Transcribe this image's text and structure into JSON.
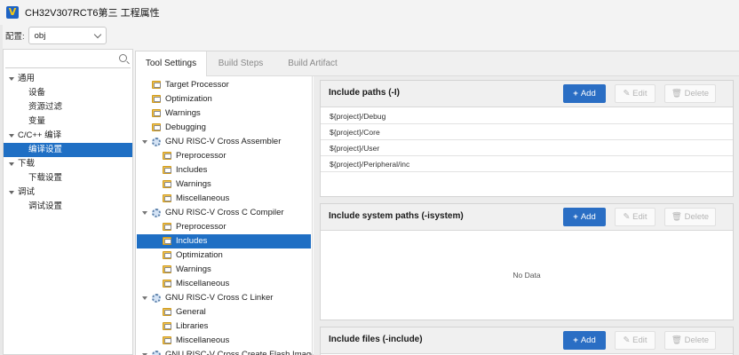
{
  "window": {
    "title": "CH32V307RCT6第三 工程属性",
    "logo": "V"
  },
  "config": {
    "label": "配置:",
    "value": "obj"
  },
  "left_tree": [
    {
      "label": "通用",
      "level": 0,
      "expanded": true
    },
    {
      "label": "设备",
      "level": 1
    },
    {
      "label": "资源过滤",
      "level": 1
    },
    {
      "label": "变量",
      "level": 1
    },
    {
      "label": "C/C++ 编译",
      "level": 0,
      "expanded": true
    },
    {
      "label": "编译设置",
      "level": 1,
      "selected": true
    },
    {
      "label": "下载",
      "level": 0,
      "expanded": true
    },
    {
      "label": "下载设置",
      "level": 1
    },
    {
      "label": "调试",
      "level": 0,
      "expanded": true
    },
    {
      "label": "调试设置",
      "level": 1
    }
  ],
  "tabs": [
    {
      "label": "Tool Settings",
      "active": true
    },
    {
      "label": "Build Steps"
    },
    {
      "label": "Build Artifact"
    }
  ],
  "tool_tree": [
    {
      "label": "Target Processor",
      "indent": 1,
      "icon": "folder-settings-icon"
    },
    {
      "label": "Optimization",
      "indent": 1,
      "icon": "folder-settings-icon"
    },
    {
      "label": "Warnings",
      "indent": 1,
      "icon": "folder-settings-icon"
    },
    {
      "label": "Debugging",
      "indent": 1,
      "icon": "folder-settings-icon"
    },
    {
      "label": "GNU RISC-V Cross Assembler",
      "indent": 0,
      "icon": "gear-icon"
    },
    {
      "label": "Preprocessor",
      "indent": 2,
      "icon": "folder-settings-icon"
    },
    {
      "label": "Includes",
      "indent": 2,
      "icon": "folder-settings-icon"
    },
    {
      "label": "Warnings",
      "indent": 2,
      "icon": "folder-settings-icon"
    },
    {
      "label": "Miscellaneous",
      "indent": 2,
      "icon": "folder-settings-icon"
    },
    {
      "label": "GNU RISC-V Cross C Compiler",
      "indent": 0,
      "icon": "gear-icon"
    },
    {
      "label": "Preprocessor",
      "indent": 2,
      "icon": "folder-settings-icon"
    },
    {
      "label": "Includes",
      "indent": 2,
      "icon": "folder-settings-icon",
      "selected": true
    },
    {
      "label": "Optimization",
      "indent": 2,
      "icon": "folder-settings-icon"
    },
    {
      "label": "Warnings",
      "indent": 2,
      "icon": "folder-settings-icon"
    },
    {
      "label": "Miscellaneous",
      "indent": 2,
      "icon": "folder-settings-icon"
    },
    {
      "label": "GNU RISC-V Cross C Linker",
      "indent": 0,
      "icon": "gear-icon"
    },
    {
      "label": "General",
      "indent": 2,
      "icon": "folder-settings-icon"
    },
    {
      "label": "Libraries",
      "indent": 2,
      "icon": "folder-settings-icon"
    },
    {
      "label": "Miscellaneous",
      "indent": 2,
      "icon": "folder-settings-icon"
    },
    {
      "label": "GNU RISC-V Cross Create Flash Image",
      "indent": 0,
      "icon": "gear-icon"
    }
  ],
  "buttons": {
    "add": "Add",
    "edit": "Edit",
    "delete": "Delete"
  },
  "sections": [
    {
      "title": "Include paths (-I)",
      "rows": [
        "${project}/Debug",
        "${project}/Core",
        "${project}/User",
        "${project}/Peripheral/inc"
      ]
    },
    {
      "title": "Include system paths (-isystem)",
      "empty_text": "No Data"
    },
    {
      "title": "Include files (-include)"
    }
  ],
  "colors": {
    "accent": "#2a6ec4",
    "selection": "#1f6fc4"
  }
}
